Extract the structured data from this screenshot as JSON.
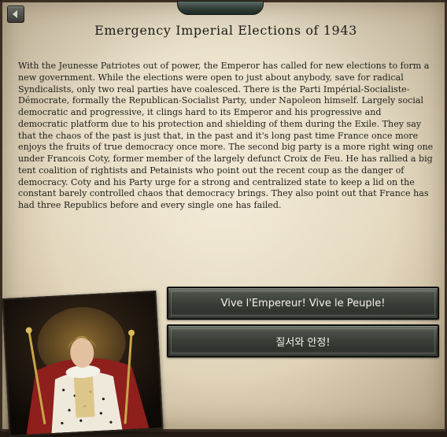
{
  "event": {
    "title": "Emergency Imperial Elections of 1943",
    "description": "With the Jeunesse Patriotes out of power, the Emperor has called for new elections to form a new government. While the elections were open to just about anybody, save for radical Syndicalists, only two real parties have coalesced. There is the Parti Impérial-Socialiste-Démocrate, formally the Republican-Socialist Party, under Napoleon himself. Largely social democratic and progressive, it clings hard to its Emperor and his progressive and democratic platform due to his protection and shielding of them during the Exile. They say that the chaos of the past is just that, in the past and it's long past time France once more enjoys the fruits of true democracy once more. The second big party is a more right wing one under Francois Coty, former member of the largely defunct Croix de Feu. He has rallied a big tent coalition of rightists and Petainists who point out the recent coup as the danger of democracy. Coty and his Party urge for a strong and centralized state to keep a lid on the constant barely controlled chaos that democracy brings. They also point out that France has had three Republics before and every single one has failed."
  },
  "options": [
    {
      "label": "Vive l'Empereur! Vive le Peuple!"
    },
    {
      "label": "질서와 안정!"
    }
  ],
  "icons": {
    "back": "left-arrow-icon",
    "picture": "emperor-portrait"
  },
  "colors": {
    "parchment": "#e6dbc3",
    "button": "#3a3e38",
    "text": "#22201b"
  }
}
